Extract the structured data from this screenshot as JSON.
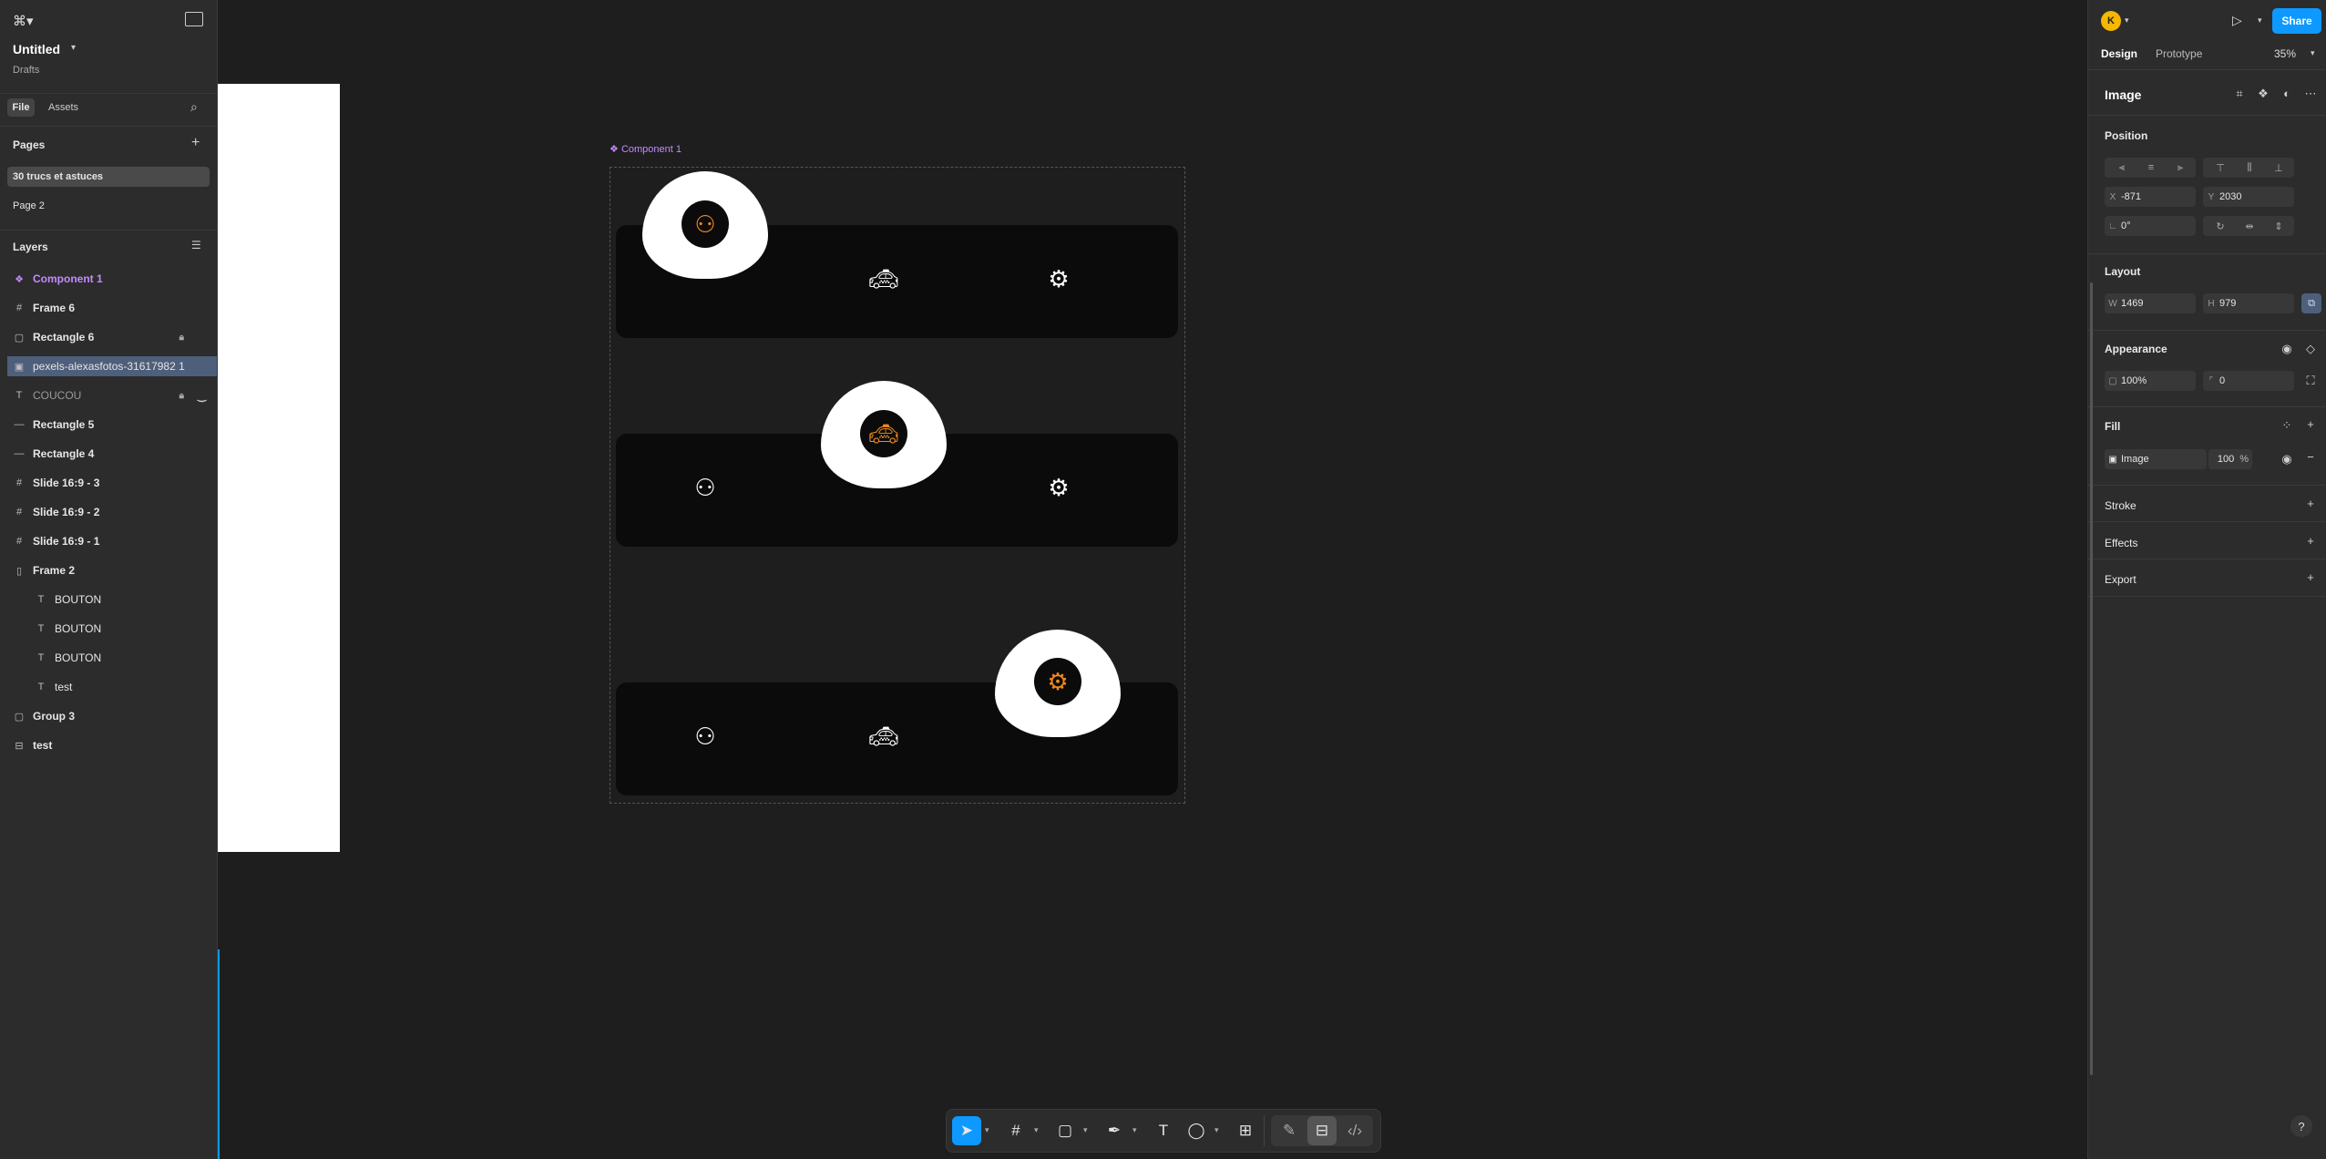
{
  "file": {
    "title": "Untitled",
    "location": "Drafts"
  },
  "left_tabs": {
    "file": "File",
    "assets": "Assets"
  },
  "pages": {
    "title": "Pages",
    "items": [
      "30 trucs et astuces",
      "Page 2"
    ]
  },
  "layers": {
    "title": "Layers",
    "items": [
      {
        "name": "Component 1",
        "icon": "component-icon"
      },
      {
        "name": "Frame 6",
        "icon": "frame-icon"
      },
      {
        "name": "Rectangle 6",
        "icon": "rectangle-icon"
      },
      {
        "name": "pexels-alexasfotos-31617982 1",
        "icon": "image-icon"
      },
      {
        "name": "COUCOU",
        "icon": "text-icon"
      },
      {
        "name": "Rectangle 5",
        "icon": "line-icon"
      },
      {
        "name": "Rectangle 4",
        "icon": "line-icon"
      },
      {
        "name": "Slide 16:9 - 3",
        "icon": "frame-icon"
      },
      {
        "name": "Slide 16:9 - 2",
        "icon": "frame-icon"
      },
      {
        "name": "Slide 16:9 - 1",
        "icon": "frame-icon"
      },
      {
        "name": "Frame 2",
        "icon": "autolayout-icon"
      },
      {
        "name": "BOUTON",
        "icon": "text-icon"
      },
      {
        "name": "BOUTON",
        "icon": "text-icon"
      },
      {
        "name": "BOUTON",
        "icon": "text-icon"
      },
      {
        "name": "test",
        "icon": "text-icon"
      },
      {
        "name": "Group 3",
        "icon": "group-icon"
      },
      {
        "name": "test",
        "icon": "section-icon"
      }
    ]
  },
  "canvas": {
    "component_label": "Component 1"
  },
  "header": {
    "avatar": "K",
    "share": "Share"
  },
  "right_tabs": {
    "design": "Design",
    "prototype": "Prototype",
    "zoom": "35%"
  },
  "selection": {
    "name": "Image"
  },
  "position": {
    "title": "Position",
    "x_label": "X",
    "x": "-871",
    "y_label": "Y",
    "y": "2030",
    "rotation": "0°"
  },
  "layout": {
    "title": "Layout",
    "w_label": "W",
    "w": "1469",
    "h_label": "H",
    "h": "979"
  },
  "appearance": {
    "title": "Appearance",
    "opacity": "100%",
    "radius": "0"
  },
  "fill": {
    "title": "Fill",
    "type": "Image",
    "opacity": "100",
    "unit": "%"
  },
  "stroke": {
    "title": "Stroke"
  },
  "effects": {
    "title": "Effects"
  },
  "export": {
    "title": "Export"
  },
  "help": "?",
  "colors": {
    "accent": "#0d99ff",
    "component": "#c28bff",
    "orange": "#f28a1c"
  }
}
